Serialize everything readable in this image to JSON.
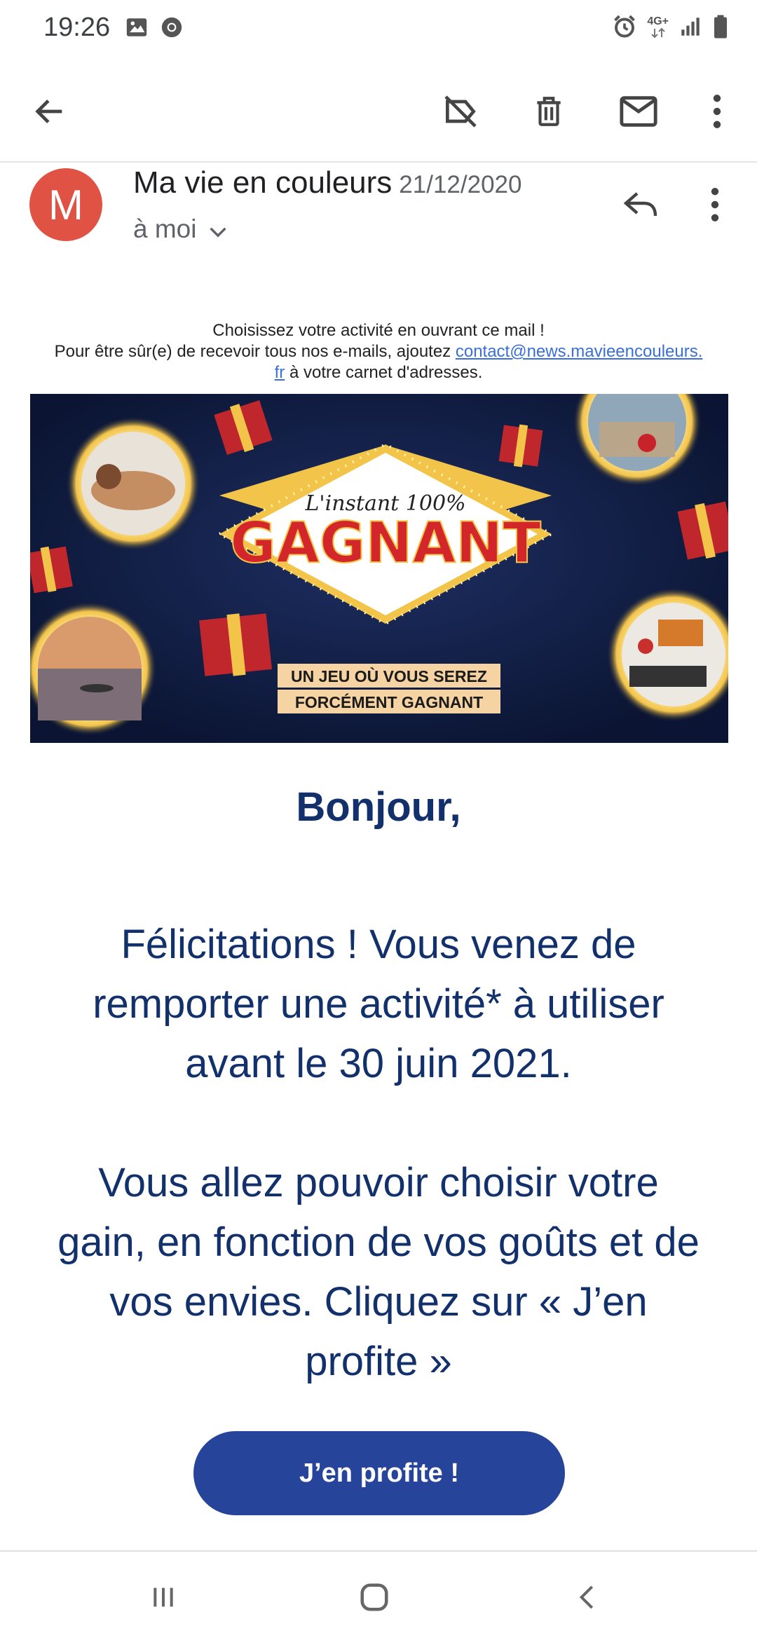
{
  "status_bar": {
    "time": "19:26",
    "network": "4G+",
    "icons": [
      "image-icon",
      "chrome-icon",
      "alarm-icon",
      "signal-icon",
      "battery-icon"
    ]
  },
  "app_bar": {
    "icons": [
      "back-arrow-icon",
      "label-off-icon",
      "delete-icon",
      "mark-unread-icon",
      "more-vert-icon"
    ]
  },
  "header": {
    "avatar_letter": "M",
    "sender_name": "Ma vie en couleurs",
    "date": "21/12/2020",
    "recipient": "à moi"
  },
  "preheader": {
    "line1": "Choisissez votre activité en ouvrant ce mail !",
    "line2_prefix": "Pour être sûr(e) de recevoir tous nos e-mails, ajoutez ",
    "email_link_part1": "contact@news.mavieencouleurs.",
    "email_link_part2": "fr",
    "line3_suffix": " à votre carnet d'adresses."
  },
  "banner": {
    "script_text": "L'instant 100%",
    "headline": "GAGNANT",
    "tagline_line1": "UN JEU OÙ VOUS SEREZ",
    "tagline_line2": "FORCÉMENT GAGNANT"
  },
  "body": {
    "greeting": "Bonjour,",
    "paragraph1": "Félicitations ! Vous venez de remporter une activité* à utiliser avant le 30 juin 2021.",
    "paragraph2": "Vous allez pouvoir choisir votre gain, en fonction de vos goûts et de vos envies. Cliquez sur « J’en profite »"
  },
  "cta": {
    "label": "J’en profite !"
  },
  "colors": {
    "navy_text": "#12306b",
    "cta_blue": "#26459a",
    "avatar_red": "#e05243",
    "link_blue": "#3a6fd8",
    "banner_bg": "#0b1533",
    "gold": "#f3c44a",
    "red_headline": "#d3262a"
  }
}
